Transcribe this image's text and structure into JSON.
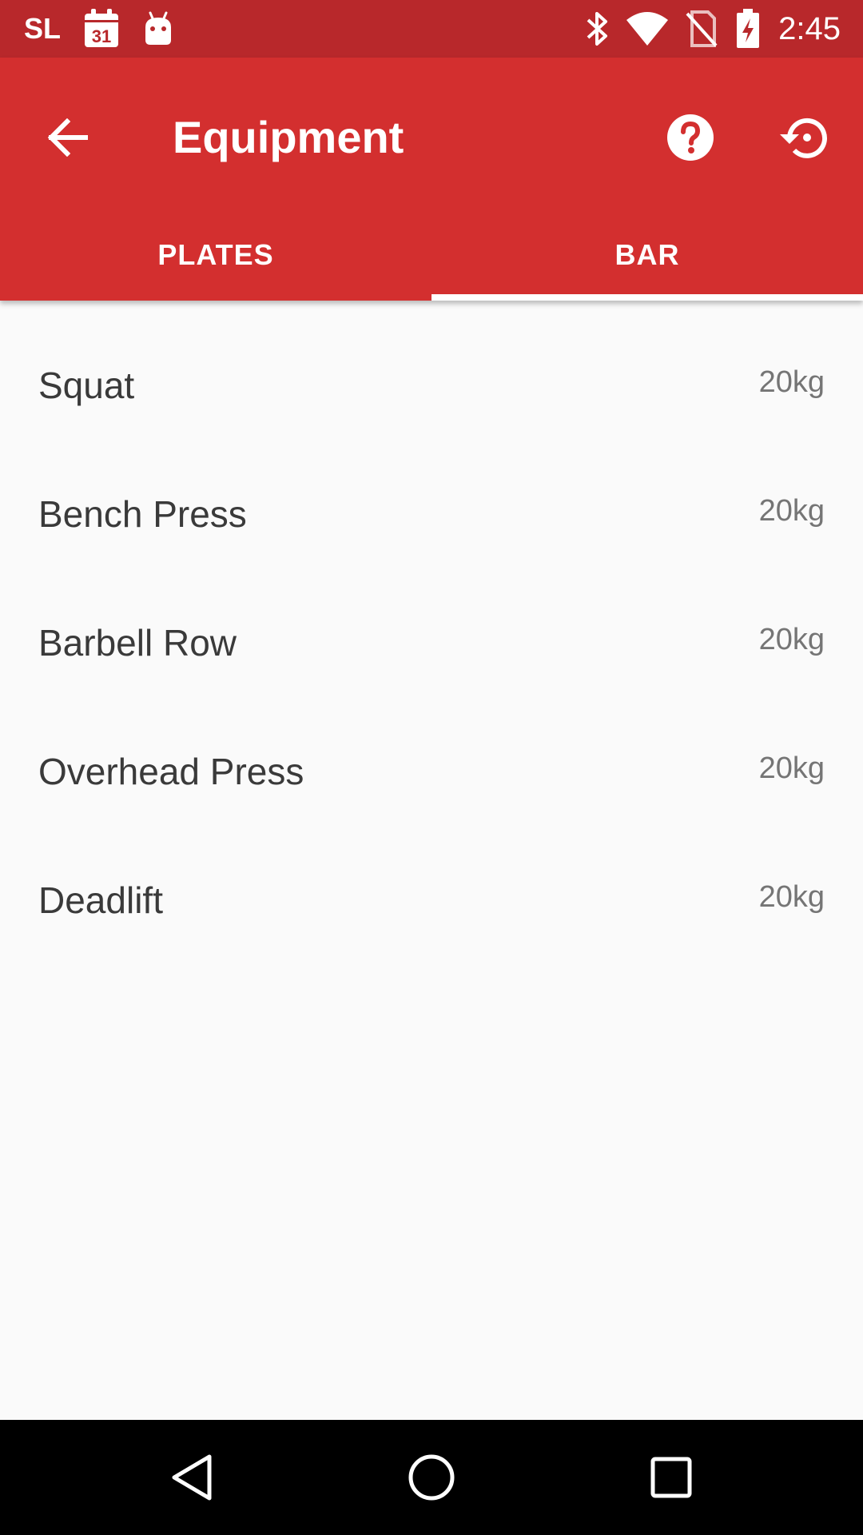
{
  "status_bar": {
    "carrier": "SL",
    "calendar_day": "31",
    "time": "2:45",
    "icons": [
      "calendar-icon",
      "android-icon",
      "bluetooth-icon",
      "wifi-icon",
      "no-sim-icon",
      "battery-charging-icon"
    ]
  },
  "toolbar": {
    "title": "Equipment",
    "icons": [
      "back-arrow-icon",
      "help-icon",
      "restore-icon"
    ]
  },
  "tabs": [
    {
      "label": "PLATES",
      "active": false
    },
    {
      "label": "BAR",
      "active": true
    }
  ],
  "bars": [
    {
      "name": "Squat",
      "weight": "20kg"
    },
    {
      "name": "Bench Press",
      "weight": "20kg"
    },
    {
      "name": "Barbell Row",
      "weight": "20kg"
    },
    {
      "name": "Overhead Press",
      "weight": "20kg"
    },
    {
      "name": "Deadlift",
      "weight": "20kg"
    }
  ],
  "nav_bar": {
    "icons": [
      "nav-back-icon",
      "nav-home-icon",
      "nav-recents-icon"
    ]
  },
  "colors": {
    "status_bar": "#b8282b",
    "app_bar": "#d32f2f",
    "background": "#fafafa",
    "text_primary": "#3a3a3a",
    "text_secondary": "#757575"
  }
}
